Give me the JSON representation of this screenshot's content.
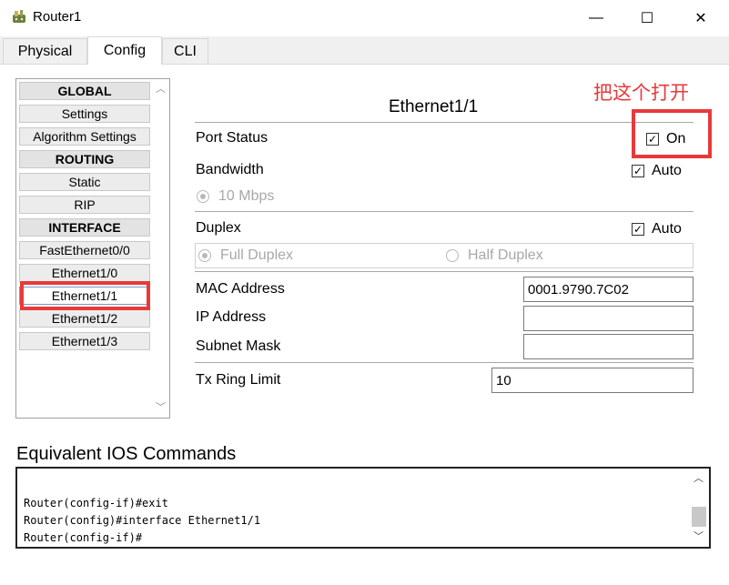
{
  "window": {
    "title": "Router1",
    "minimize_glyph": "—",
    "maximize_glyph": "☐",
    "close_glyph": "✕"
  },
  "tabs": [
    {
      "label": "Physical"
    },
    {
      "label": "Config"
    },
    {
      "label": "CLI"
    }
  ],
  "sidebar": {
    "items": [
      {
        "label": "GLOBAL",
        "type": "header"
      },
      {
        "label": "Settings",
        "type": "item"
      },
      {
        "label": "Algorithm Settings",
        "type": "item"
      },
      {
        "label": "ROUTING",
        "type": "header"
      },
      {
        "label": "Static",
        "type": "item"
      },
      {
        "label": "RIP",
        "type": "item"
      },
      {
        "label": "INTERFACE",
        "type": "header"
      },
      {
        "label": "FastEthernet0/0",
        "type": "item"
      },
      {
        "label": "Ethernet1/0",
        "type": "item"
      },
      {
        "label": "Ethernet1/1",
        "type": "item",
        "selected": true
      },
      {
        "label": "Ethernet1/2",
        "type": "item"
      },
      {
        "label": "Ethernet1/3",
        "type": "item"
      }
    ]
  },
  "annotation": {
    "text": "把这个打开",
    "color": "#e8393b"
  },
  "panel": {
    "title": "Ethernet1/1",
    "port_status": {
      "label": "Port Status",
      "checkbox_label": "On",
      "checked": true
    },
    "bandwidth": {
      "label": "Bandwidth",
      "auto_label": "Auto",
      "auto_checked": true,
      "option": "10 Mbps"
    },
    "duplex": {
      "label": "Duplex",
      "auto_label": "Auto",
      "auto_checked": true,
      "full": "Full Duplex",
      "half": "Half Duplex"
    },
    "mac": {
      "label": "MAC Address",
      "value": "0001.9790.7C02"
    },
    "ip": {
      "label": "IP Address",
      "value": ""
    },
    "subnet": {
      "label": "Subnet Mask",
      "value": ""
    },
    "tx_ring": {
      "label": "Tx Ring Limit",
      "value": "10"
    }
  },
  "ios": {
    "heading": "Equivalent IOS Commands",
    "lines": [
      "Router(config-if)#exit",
      "Router(config)#interface Ethernet1/1",
      "Router(config-if)#"
    ]
  }
}
